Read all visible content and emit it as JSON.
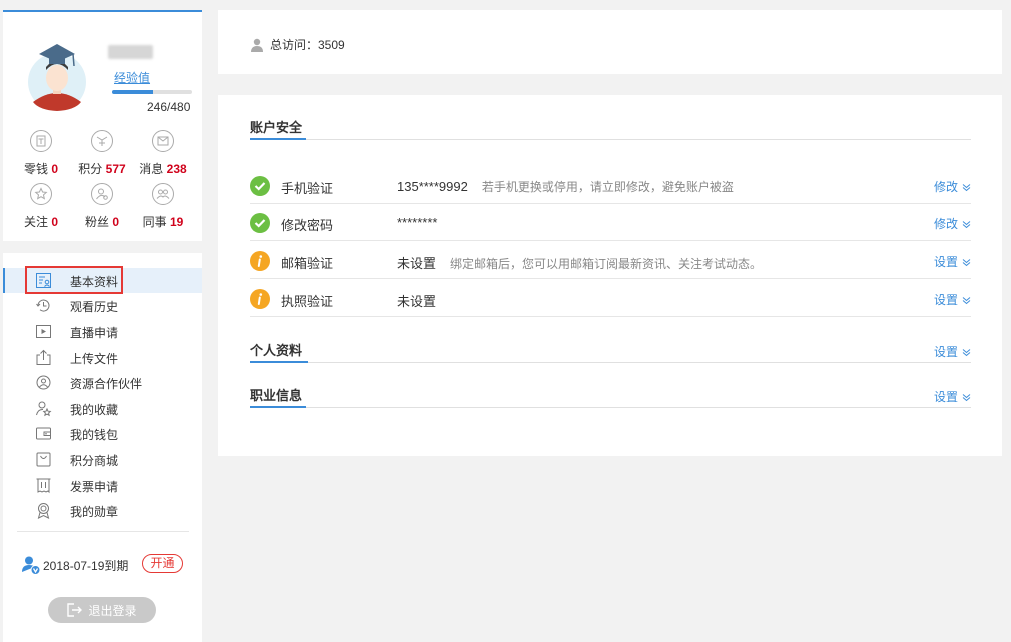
{
  "profile": {
    "exp_link": "经验值",
    "exp_text": "246/480",
    "exp_fraction": 0.5125,
    "stats": [
      {
        "icon": "coin-icon",
        "label": "零钱",
        "value": "0"
      },
      {
        "icon": "points-icon",
        "label": "积分",
        "value": "577"
      },
      {
        "icon": "message-icon",
        "label": "消息",
        "value": "238"
      },
      {
        "icon": "star-follow-icon",
        "label": "关注",
        "value": "0"
      },
      {
        "icon": "fans-icon",
        "label": "粉丝",
        "value": "0"
      },
      {
        "icon": "colleagues-icon",
        "label": "同事",
        "value": "19"
      }
    ]
  },
  "menu": {
    "items": [
      {
        "icon": "profile-card-icon",
        "label": "基本资料",
        "active": true
      },
      {
        "icon": "history-icon",
        "label": "观看历史"
      },
      {
        "icon": "live-icon",
        "label": "直播申请"
      },
      {
        "icon": "upload-icon",
        "label": "上传文件"
      },
      {
        "icon": "partner-icon",
        "label": "资源合作伙伴"
      },
      {
        "icon": "favorites-icon",
        "label": "我的收藏"
      },
      {
        "icon": "wallet-icon",
        "label": "我的钱包"
      },
      {
        "icon": "shop-icon",
        "label": "积分商城"
      },
      {
        "icon": "invoice-icon",
        "label": "发票申请"
      },
      {
        "icon": "medal-icon",
        "label": "我的勋章"
      }
    ],
    "vip_date": "2018-07-19到期",
    "vip_button": "开通",
    "logout": "退出登录"
  },
  "visits": {
    "text": "总访问：3509"
  },
  "account_security": {
    "title": "账户安全",
    "rows": [
      {
        "status": "ok",
        "name": "手机验证",
        "value": "135****9992",
        "desc": "若手机更换或停用，请立即修改，避免账户被盗",
        "action": "修改"
      },
      {
        "status": "ok",
        "name": "修改密码",
        "value": "********",
        "desc": "",
        "action": "修改"
      },
      {
        "status": "warn",
        "name": "邮箱验证",
        "value": "未设置",
        "desc": "绑定邮箱后，您可以用邮箱订阅最新资讯、关注考试动态。",
        "action": "设置"
      },
      {
        "status": "warn",
        "name": "执照验证",
        "value": "未设置",
        "desc": "",
        "action": "设置"
      }
    ]
  },
  "personal_info": {
    "title": "个人资料",
    "action": "设置"
  },
  "career_info": {
    "title": "职业信息",
    "action": "设置"
  },
  "colors": {
    "accent": "#3b8cd9",
    "ok": "#6cbf43",
    "warn": "#f5a623",
    "danger": "#d0021b"
  }
}
